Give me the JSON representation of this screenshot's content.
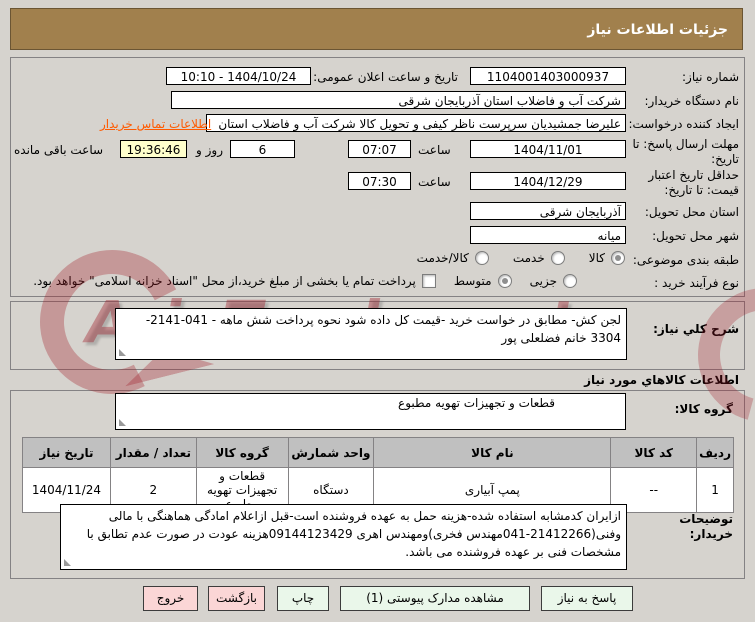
{
  "header": {
    "title": "جزئیات اطلاعات نیاز"
  },
  "watermark": {
    "text": "AriaTender.net"
  },
  "info": {
    "need_number": {
      "label": "شماره نیاز:",
      "value": "1104001403000937"
    },
    "announce": {
      "label": "تاریخ و ساعت اعلان عمومی:",
      "value": "1404/10/24 - 10:10"
    },
    "buyer_org": {
      "label": "نام دستگاه خریدار:",
      "value": "شرکت آب و فاضلاب استان آذربایجان شرقی"
    },
    "creator": {
      "label": "ایجاد کننده درخواست:",
      "value": "علیرضا جمشیدیان سرپرست ناظر کیفی و تحویل کالا شرکت آب و فاضلاب استان",
      "contact_link": "اطلاعات تماس خریدار"
    },
    "deadline": {
      "label": "مهلت ارسال پاسخ: تا تاریخ:",
      "date": "1404/11/01",
      "hour_label": "ساعت",
      "hour": "07:07",
      "days": "6",
      "days_label": "روز و",
      "remaining": "19:36:46",
      "remaining_label": "ساعت باقی مانده"
    },
    "price_validity": {
      "label": "حداقل تاریخ اعتبار قیمت: تا تاریخ:",
      "date": "1404/12/29",
      "hour_label": "ساعت",
      "hour": "07:30"
    },
    "province": {
      "label": "استان محل تحویل:",
      "value": "آذربایجان شرقی"
    },
    "city": {
      "label": "شهر محل تحویل:",
      "value": "میانه"
    },
    "classification": {
      "label": "طبقه بندی موضوعی:",
      "options": [
        {
          "label": "کالا",
          "selected": true
        },
        {
          "label": "خدمت",
          "selected": false
        },
        {
          "label": "کالا/خدمت",
          "selected": false
        }
      ]
    },
    "process": {
      "label": "نوع فرآیند خرید :",
      "options": [
        {
          "label": "جزیی",
          "selected": false
        },
        {
          "label": "متوسط",
          "selected": true
        }
      ],
      "checkbox_label": "پرداخت تمام یا بخشی از مبلغ خرید،از محل \"اسناد خزانه اسلامی\" خواهد بود.",
      "checkbox_checked": false
    }
  },
  "description": {
    "label": "شرح کلي نیاز:",
    "value": "لجن کش- مطابق در خواست خرید -قیمت کل داده شود نحوه پرداخت شش ماهه - 041-2141-3304 خانم فضلعلی پور"
  },
  "goods": {
    "section_title": "اطلاعات کالاهاي مورد نیاز",
    "group": {
      "label": "گروه کالا:",
      "value": "قطعات و تجهیزات تهویه مطبوع"
    },
    "table": {
      "headers": [
        "ردیف",
        "کد کالا",
        "نام کالا",
        "واحد شمارش",
        "گروه کالا",
        "تعداد / مقدار",
        "تاریخ نیاز"
      ],
      "rows": [
        [
          "1",
          "--",
          "پمپ آبیاری",
          "دستگاه",
          "قطعات و تجهیزات تهویه مطبوع",
          "2",
          "1404/11/24"
        ]
      ]
    }
  },
  "buyer_notes": {
    "label": "توضیحات خریدار:",
    "value": "ازایران کدمشابه استفاده شده-هزینه حمل به عهده فروشنده است-قبل ازاعلام امادگی هماهنگی با مالی وفنی(21412266-041مهندس فخری)ومهندس اهری 09144123429هزینه عودت در صورت عدم تطابق با مشخصات فنی بر عهده فروشنده می باشد."
  },
  "buttons": [
    {
      "label": "پاسخ به نیاز",
      "type": "green"
    },
    {
      "label": "مشاهده مدارک پیوستی (1)",
      "type": "green"
    },
    {
      "label": "چاپ",
      "type": "green"
    },
    {
      "label": "بازگشت",
      "type": "pink"
    },
    {
      "label": "خروج",
      "type": "pink"
    }
  ],
  "colors": {
    "header_bg": "#a1804d",
    "contact_link": "#ff5a00",
    "remaining_highlight": "#ffffcc",
    "table_header_bg": "#c0c0c0",
    "button_green": "#eaf7ea",
    "button_pink": "#fbd6d6",
    "watermark_red": "#9e1824"
  }
}
